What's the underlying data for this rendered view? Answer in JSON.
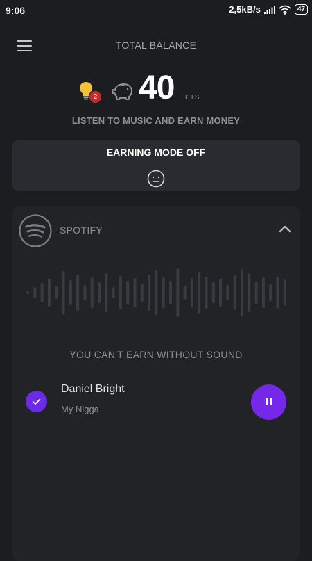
{
  "status_bar": {
    "time": "9:06",
    "net_speed": "2,5kB/s",
    "battery": "47"
  },
  "header": {
    "title": "TOTAL BALANCE",
    "menu_icon": "hamburger-menu-icon"
  },
  "balance": {
    "badge_count": "2",
    "points": "40",
    "unit": "PTS",
    "bulb_icon": "lightbulb-icon",
    "piggy_icon": "piggy-bank-icon"
  },
  "subtitle": "LISTEN TO MUSIC AND EARN MONEY",
  "earning_mode": {
    "label": "EARNING MODE OFF",
    "icon": "neutral-face-icon"
  },
  "player": {
    "service": "SPOTIFY",
    "service_icon": "spotify-logo-icon",
    "collapse_icon": "chevron-up-icon",
    "warning": "YOU CAN'T EARN WITHOUT SOUND",
    "track": {
      "title": "Daniel Bright",
      "subtitle": "My Nigga",
      "selected": true
    },
    "pause_icon": "pause-icon"
  },
  "colors": {
    "background": "#1c1d21",
    "card": "#2a2b30",
    "accent": "#7628ea",
    "badge": "#c62b2e"
  }
}
